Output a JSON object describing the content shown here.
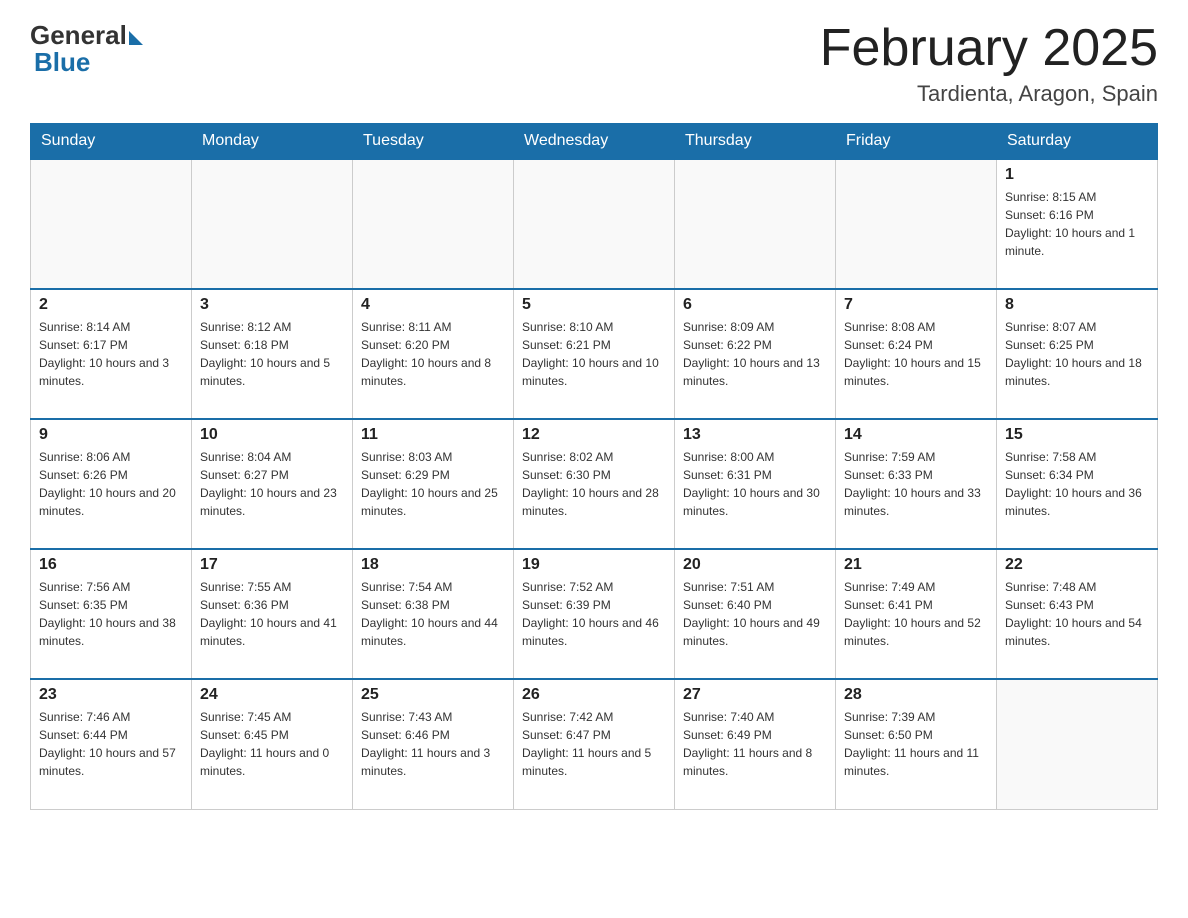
{
  "header": {
    "logo_general": "General",
    "logo_blue": "Blue",
    "month_title": "February 2025",
    "location": "Tardienta, Aragon, Spain"
  },
  "weekdays": [
    "Sunday",
    "Monday",
    "Tuesday",
    "Wednesday",
    "Thursday",
    "Friday",
    "Saturday"
  ],
  "weeks": [
    [
      {
        "day": "",
        "info": ""
      },
      {
        "day": "",
        "info": ""
      },
      {
        "day": "",
        "info": ""
      },
      {
        "day": "",
        "info": ""
      },
      {
        "day": "",
        "info": ""
      },
      {
        "day": "",
        "info": ""
      },
      {
        "day": "1",
        "info": "Sunrise: 8:15 AM\nSunset: 6:16 PM\nDaylight: 10 hours and 1 minute."
      }
    ],
    [
      {
        "day": "2",
        "info": "Sunrise: 8:14 AM\nSunset: 6:17 PM\nDaylight: 10 hours and 3 minutes."
      },
      {
        "day": "3",
        "info": "Sunrise: 8:12 AM\nSunset: 6:18 PM\nDaylight: 10 hours and 5 minutes."
      },
      {
        "day": "4",
        "info": "Sunrise: 8:11 AM\nSunset: 6:20 PM\nDaylight: 10 hours and 8 minutes."
      },
      {
        "day": "5",
        "info": "Sunrise: 8:10 AM\nSunset: 6:21 PM\nDaylight: 10 hours and 10 minutes."
      },
      {
        "day": "6",
        "info": "Sunrise: 8:09 AM\nSunset: 6:22 PM\nDaylight: 10 hours and 13 minutes."
      },
      {
        "day": "7",
        "info": "Sunrise: 8:08 AM\nSunset: 6:24 PM\nDaylight: 10 hours and 15 minutes."
      },
      {
        "day": "8",
        "info": "Sunrise: 8:07 AM\nSunset: 6:25 PM\nDaylight: 10 hours and 18 minutes."
      }
    ],
    [
      {
        "day": "9",
        "info": "Sunrise: 8:06 AM\nSunset: 6:26 PM\nDaylight: 10 hours and 20 minutes."
      },
      {
        "day": "10",
        "info": "Sunrise: 8:04 AM\nSunset: 6:27 PM\nDaylight: 10 hours and 23 minutes."
      },
      {
        "day": "11",
        "info": "Sunrise: 8:03 AM\nSunset: 6:29 PM\nDaylight: 10 hours and 25 minutes."
      },
      {
        "day": "12",
        "info": "Sunrise: 8:02 AM\nSunset: 6:30 PM\nDaylight: 10 hours and 28 minutes."
      },
      {
        "day": "13",
        "info": "Sunrise: 8:00 AM\nSunset: 6:31 PM\nDaylight: 10 hours and 30 minutes."
      },
      {
        "day": "14",
        "info": "Sunrise: 7:59 AM\nSunset: 6:33 PM\nDaylight: 10 hours and 33 minutes."
      },
      {
        "day": "15",
        "info": "Sunrise: 7:58 AM\nSunset: 6:34 PM\nDaylight: 10 hours and 36 minutes."
      }
    ],
    [
      {
        "day": "16",
        "info": "Sunrise: 7:56 AM\nSunset: 6:35 PM\nDaylight: 10 hours and 38 minutes."
      },
      {
        "day": "17",
        "info": "Sunrise: 7:55 AM\nSunset: 6:36 PM\nDaylight: 10 hours and 41 minutes."
      },
      {
        "day": "18",
        "info": "Sunrise: 7:54 AM\nSunset: 6:38 PM\nDaylight: 10 hours and 44 minutes."
      },
      {
        "day": "19",
        "info": "Sunrise: 7:52 AM\nSunset: 6:39 PM\nDaylight: 10 hours and 46 minutes."
      },
      {
        "day": "20",
        "info": "Sunrise: 7:51 AM\nSunset: 6:40 PM\nDaylight: 10 hours and 49 minutes."
      },
      {
        "day": "21",
        "info": "Sunrise: 7:49 AM\nSunset: 6:41 PM\nDaylight: 10 hours and 52 minutes."
      },
      {
        "day": "22",
        "info": "Sunrise: 7:48 AM\nSunset: 6:43 PM\nDaylight: 10 hours and 54 minutes."
      }
    ],
    [
      {
        "day": "23",
        "info": "Sunrise: 7:46 AM\nSunset: 6:44 PM\nDaylight: 10 hours and 57 minutes."
      },
      {
        "day": "24",
        "info": "Sunrise: 7:45 AM\nSunset: 6:45 PM\nDaylight: 11 hours and 0 minutes."
      },
      {
        "day": "25",
        "info": "Sunrise: 7:43 AM\nSunset: 6:46 PM\nDaylight: 11 hours and 3 minutes."
      },
      {
        "day": "26",
        "info": "Sunrise: 7:42 AM\nSunset: 6:47 PM\nDaylight: 11 hours and 5 minutes."
      },
      {
        "day": "27",
        "info": "Sunrise: 7:40 AM\nSunset: 6:49 PM\nDaylight: 11 hours and 8 minutes."
      },
      {
        "day": "28",
        "info": "Sunrise: 7:39 AM\nSunset: 6:50 PM\nDaylight: 11 hours and 11 minutes."
      },
      {
        "day": "",
        "info": ""
      }
    ]
  ]
}
